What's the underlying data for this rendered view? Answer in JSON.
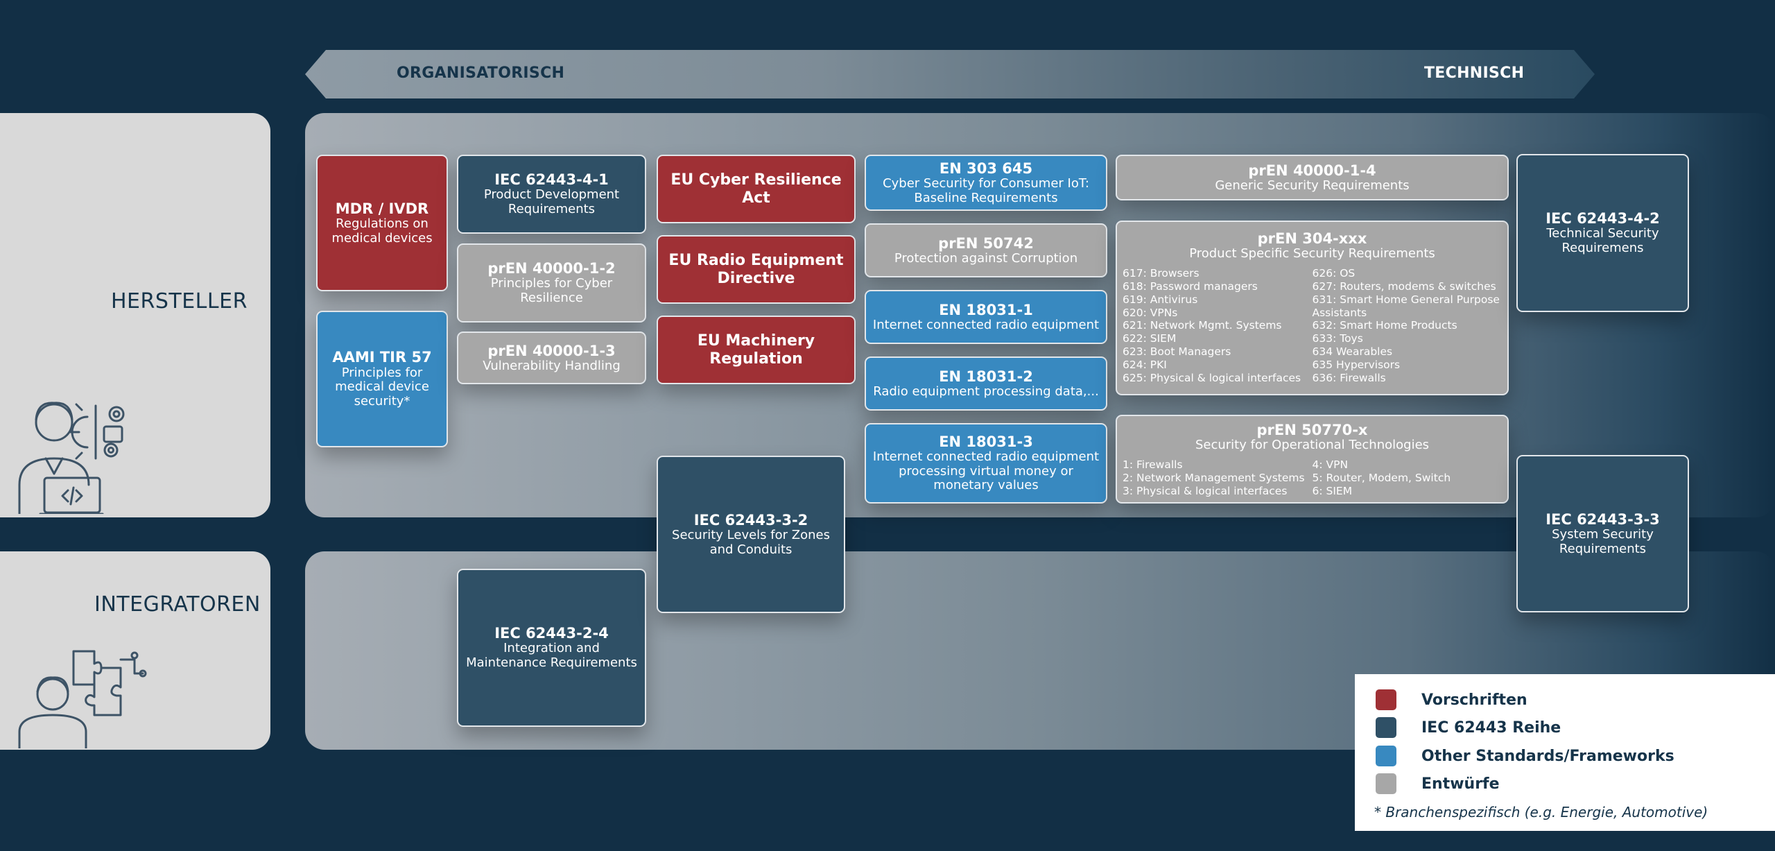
{
  "arrow": {
    "left": "ORGANISATORISCH",
    "right": "TECHNISCH"
  },
  "roles": {
    "hersteller": "HERSTELLER",
    "integratoren": "INTEGRATOREN"
  },
  "boxes": {
    "mdr": {
      "title": "MDR / IVDR",
      "sub": "Regulations on medical devices"
    },
    "aami": {
      "title": "AAMI TIR 57",
      "sub": "Principles for medical device security*"
    },
    "iec_4_1": {
      "title": "IEC 62443-4-1",
      "sub": "Product Development Requirements"
    },
    "pren_1_2": {
      "title": "prEN 40000-1-2",
      "sub": "Principles for Cyber Resilience"
    },
    "pren_1_3": {
      "title": "prEN 40000-1-3",
      "sub": "Vulnerability Handling"
    },
    "cra": {
      "title": "EU Cyber Resilience Act"
    },
    "red": {
      "title": "EU Radio Equipment Directive"
    },
    "machinery": {
      "title": "EU Machinery Regulation"
    },
    "iec_3_2": {
      "title": "IEC 62443-3-2",
      "sub1": "Security Levels for Zones",
      "sub2": "and Conduits"
    },
    "en303": {
      "title": "EN 303 645",
      "sub": "Cyber Security for Consumer IoT: Baseline Requirements"
    },
    "pren50742": {
      "title": "prEN 50742",
      "sub": "Protection against Corruption"
    },
    "en18031_1": {
      "title": "EN 18031-1",
      "sub": "Internet connected radio equipment"
    },
    "en18031_2": {
      "title": "EN 18031-2",
      "sub": "Radio equipment processing data,..."
    },
    "en18031_3": {
      "title": "EN 18031-3",
      "sub": "Internet connected radio equipment processing virtual money or monetary values"
    },
    "pren_1_4": {
      "title": "prEN 40000-1-4",
      "sub": "Generic Security Requirements"
    },
    "pren304": {
      "title": "prEN 304-xxx",
      "sub": "Product Specific Security Requirements",
      "left": [
        "617: Browsers",
        "618: Password managers",
        "619: Antivirus",
        "620: VPNs",
        "621: Network Mgmt. Systems",
        "622: SIEM",
        "623: Boot Managers",
        "624: PKI",
        "625: Physical & logical interfaces"
      ],
      "right": [
        "626: OS",
        "627: Routers, modems & switches",
        "631: Smart Home General Purpose Assistants",
        "632: Smart Home Products",
        "633: Toys",
        "634 Wearables",
        "635 Hypervisors",
        "636: Firewalls"
      ]
    },
    "pren50770": {
      "title": "prEN 50770-x",
      "sub": "Security for Operational Technologies",
      "left": [
        "1: Firewalls",
        "2: Network Management Systems",
        "3: Physical & logical interfaces"
      ],
      "right": [
        "4: VPN",
        "5: Router, Modem, Switch",
        "6: SIEM"
      ]
    },
    "iec_4_2": {
      "title": "IEC 62443-4-2",
      "sub": "Technical Security Requiremens"
    },
    "iec_3_3": {
      "title": "IEC 62443-3-3",
      "sub": "System Security Requirements"
    },
    "iec_2_4": {
      "title": "IEC 62443-2-4",
      "sub": "Integration and Maintenance Requirements"
    }
  },
  "legend": {
    "items": [
      {
        "label": "Vorschriften",
        "color": "#9f3035"
      },
      {
        "label": "IEC 62443 Reihe",
        "color": "#2f5066"
      },
      {
        "label": "Other Standards/Frameworks",
        "color": "#3889c0"
      },
      {
        "label": "Entwürfe",
        "color": "#a7a7a7"
      }
    ],
    "note": "* Branchenspezifisch (e.g. Energie, Automotive)"
  },
  "icons": {
    "hersteller": "developer-person-icon",
    "integratoren": "puzzle-person-icon"
  }
}
